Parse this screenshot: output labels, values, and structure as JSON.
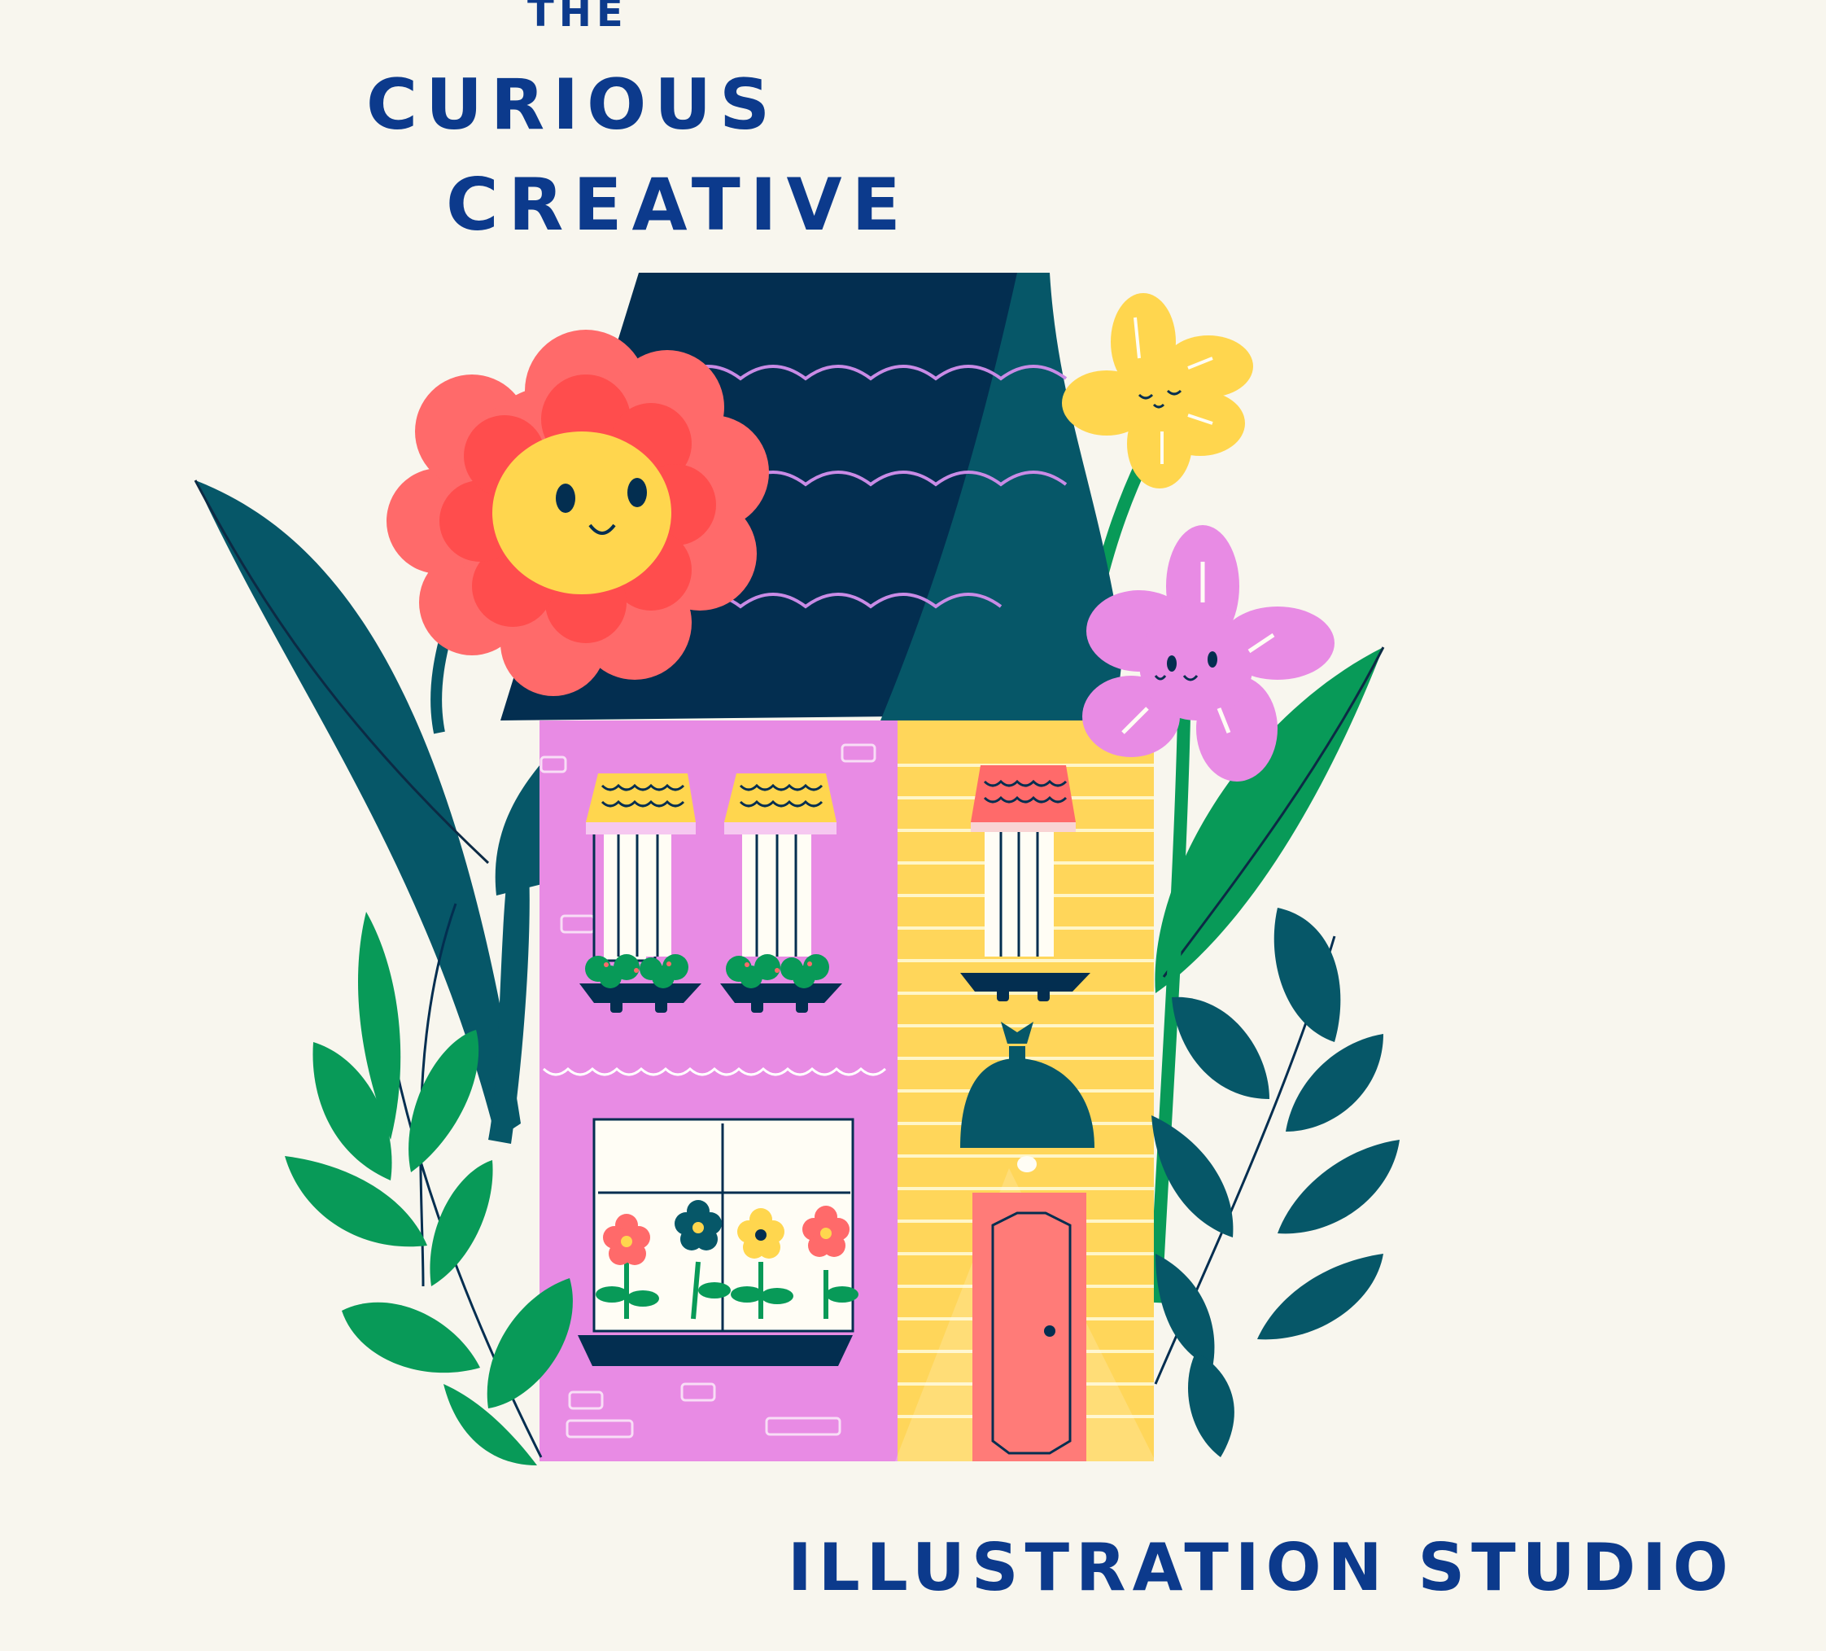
{
  "brand": {
    "line1": "THE",
    "line2": "CURIOUS",
    "line3": "CREATIVE",
    "tagline": "ILLUSTRATION STUDIO"
  },
  "colors": {
    "background": "#F8F6EE",
    "text": "#0C3A8C",
    "roof_dark": "#032E50",
    "roof_teal": "#065768",
    "house_pink": "#E88BE4",
    "house_yellow": "#FFD65A",
    "door": "#FF7B78",
    "leaf_green": "#089A58",
    "leaf_teal": "#065768",
    "flower_red": "#FF5A5A",
    "flower_yellow": "#FFD64E",
    "flower_purple": "#E88BE4"
  },
  "illustration": {
    "subject": "house-with-flowers",
    "flowers": [
      "red-smiling-flower-icon",
      "yellow-smiling-flower-icon",
      "purple-smiling-flower-icon"
    ]
  }
}
